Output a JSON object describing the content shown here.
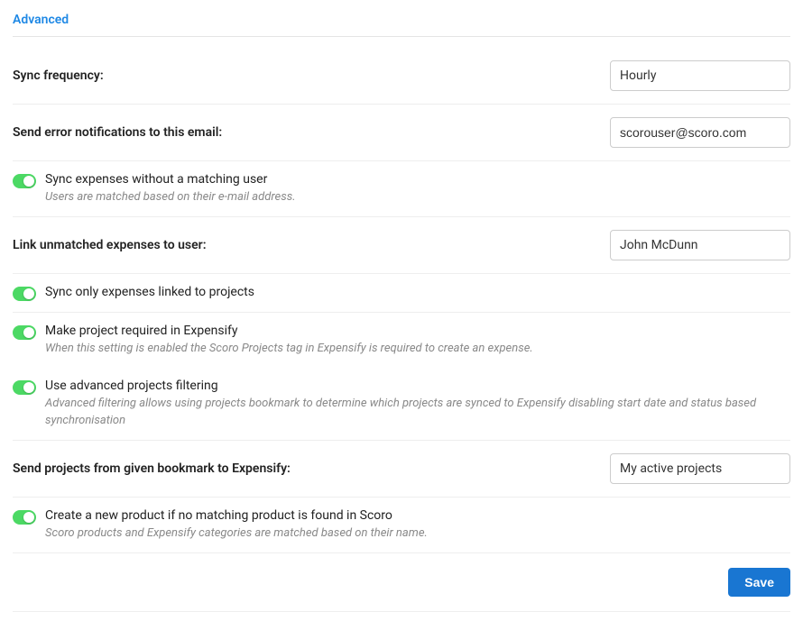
{
  "section": {
    "title": "Advanced"
  },
  "fields": {
    "sync_frequency": {
      "label": "Sync frequency:",
      "value": "Hourly"
    },
    "error_email": {
      "label": "Send error notifications to this email:",
      "value": "scorouser@scoro.com"
    },
    "link_unmatched_user": {
      "label": "Link unmatched expenses to user:",
      "value": "John McDunn"
    },
    "bookmark": {
      "label": "Send projects from given bookmark to Expensify:",
      "value": "My active projects"
    }
  },
  "toggles": {
    "sync_no_user": {
      "label": "Sync expenses without a matching user",
      "desc": "Users are matched based on their e-mail address."
    },
    "sync_linked_projects": {
      "label": "Sync only expenses linked to projects"
    },
    "project_required": {
      "label": "Make project required in Expensify",
      "desc": "When this setting is enabled the Scoro Projects tag in Expensify is required to create an expense."
    },
    "advanced_filtering": {
      "label": "Use advanced projects filtering",
      "desc": "Advanced filtering allows using projects bookmark to determine which projects are synced to Expensify disabling start date and status based synchronisation"
    },
    "create_product": {
      "label": "Create a new product if no matching product is found in Scoro",
      "desc": "Scoro products and Expensify categories are matched based on their name."
    }
  },
  "buttons": {
    "save": "Save"
  }
}
